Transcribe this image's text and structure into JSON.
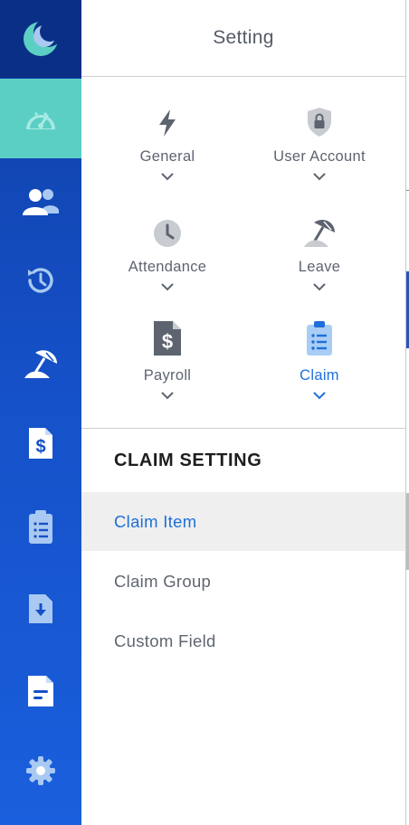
{
  "rail": {
    "items": [
      {
        "icon": "moon-logo-icon",
        "active": false
      },
      {
        "icon": "dashboard-gauge-icon",
        "active": true
      },
      {
        "icon": "users-icon",
        "active": false
      },
      {
        "icon": "history-icon",
        "active": false
      },
      {
        "icon": "beach-umbrella-icon",
        "active": false
      },
      {
        "icon": "payroll-document-icon",
        "active": false
      },
      {
        "icon": "clipboard-icon",
        "active": false
      },
      {
        "icon": "download-file-icon",
        "active": false
      },
      {
        "icon": "report-document-icon",
        "active": false
      },
      {
        "icon": "settings-gear-icon",
        "active": false
      }
    ],
    "colors": {
      "background": "#1550c7",
      "active": "#5ccfc4",
      "logo_bg": "#0a2f87"
    }
  },
  "panel": {
    "title": "Setting",
    "categories": [
      {
        "label": "General",
        "icon": "lightning-icon",
        "selected": false
      },
      {
        "label": "User Account",
        "icon": "shield-lock-icon",
        "selected": false
      },
      {
        "label": "Attendance",
        "icon": "clock-icon",
        "selected": false
      },
      {
        "label": "Leave",
        "icon": "beach-umbrella-icon",
        "selected": false
      },
      {
        "label": "Payroll",
        "icon": "dollar-document-icon",
        "selected": false
      },
      {
        "label": "Claim",
        "icon": "clipboard-list-icon",
        "selected": true
      }
    ],
    "section_title": "CLAIM SETTING",
    "menu": [
      {
        "label": "Claim Item",
        "active": true
      },
      {
        "label": "Claim Group",
        "active": false
      },
      {
        "label": "Custom Field",
        "active": false
      }
    ],
    "colors": {
      "accent": "#1e6fd8",
      "text": "#5d6470",
      "active_row": "#efefef"
    }
  }
}
